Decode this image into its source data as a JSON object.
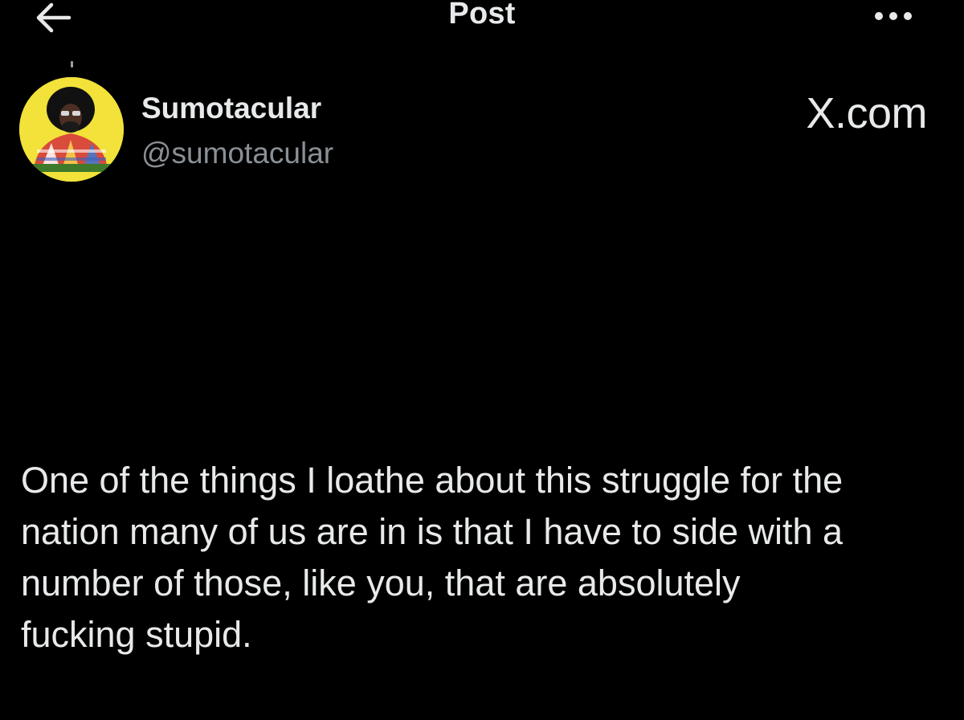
{
  "header": {
    "title": "Post",
    "back_icon": "arrow-left-icon",
    "more_icon": "more-horizontal-icon"
  },
  "author": {
    "display_name": "Sumotacular",
    "handle": "@sumotacular",
    "avatar_icon": "avatar-image"
  },
  "brand": {
    "text": "X.com"
  },
  "post": {
    "text": "One of the things I loathe about this struggle for the\nnation many of us are in is that I have to side with a\nnumber of those, like you, that are absolutely\nfucking stupid."
  },
  "colors": {
    "background": "#000000",
    "primary_text": "#e7e9ea",
    "secondary_text": "#8b9096",
    "avatar_bg": "#f2e23a"
  }
}
